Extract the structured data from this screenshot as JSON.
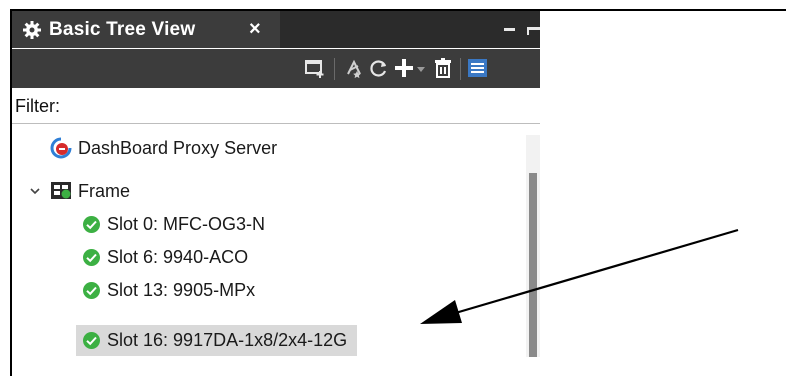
{
  "window": {
    "tab_title": "Basic Tree View",
    "close_glyph": "×",
    "tab_icon": "gear-icon"
  },
  "toolbar": {
    "icons": [
      "new-window-icon",
      "filter-star-icon",
      "refresh-icon",
      "add-icon",
      "dropdown-caret-icon",
      "delete-icon",
      "list-view-icon"
    ]
  },
  "filter": {
    "label": "Filter:",
    "value": "",
    "placeholder": ""
  },
  "tree": {
    "items": [
      {
        "label": "DashBoard Proxy Server",
        "icon": "proxy-server-icon"
      },
      {
        "label": "Frame",
        "icon": "frame-icon",
        "expanded": true
      },
      {
        "label": "Slot 0: MFC-OG3-N",
        "icon": "status-ok-icon"
      },
      {
        "label": "Slot 6: 9940-ACO",
        "icon": "status-ok-icon"
      },
      {
        "label": "Slot 13: 9905-MPx",
        "icon": "status-ok-icon"
      },
      {
        "label": "Slot 16: 9917DA-1x8/2x4-12G",
        "icon": "status-ok-icon",
        "selected": true
      }
    ]
  },
  "colors": {
    "tab_bg": "#3c3c3c",
    "toolbar_bg": "#3c3c3c",
    "status_ok": "#3cb043",
    "selection": "#d9d9d9",
    "proxy_red": "#d62b2b",
    "proxy_blue": "#2f7fd6"
  }
}
